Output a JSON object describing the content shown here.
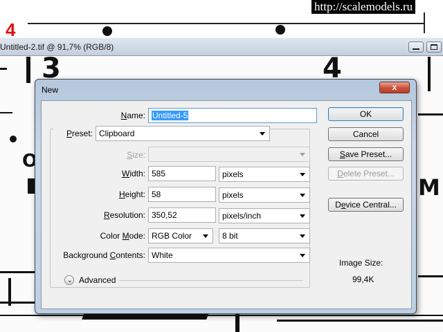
{
  "watermark": "http://scalemodels.ru",
  "step_number": "4",
  "document_window": {
    "title": "Untitled-2.tif @ 91,7% (RGB/8)",
    "minimize_label": "",
    "maximize_label": ""
  },
  "background_glyphs": [
    "3",
    "4",
    "M",
    "O"
  ],
  "dialog": {
    "title": "New",
    "close_label": "x",
    "name": {
      "label_u": "N",
      "label_rest": "ame:",
      "value": "Untitled-5"
    },
    "preset": {
      "label_u": "P",
      "label_rest": "reset:",
      "value": "Clipboard"
    },
    "size": {
      "label_u": "S",
      "label_rest": "ize:",
      "value": ""
    },
    "width": {
      "label_u": "W",
      "label_rest": "idth:",
      "value": "585",
      "unit": "pixels"
    },
    "height": {
      "label_u": "H",
      "label_rest": "eight:",
      "value": "58",
      "unit": "pixels"
    },
    "resolution": {
      "label_u": "R",
      "label_rest": "esolution:",
      "value": "350,52",
      "unit": "pixels/inch"
    },
    "color_mode": {
      "label_pre": "Color ",
      "label_u": "M",
      "label_rest": "ode:",
      "value": "RGB Color",
      "depth": "8 bit"
    },
    "background": {
      "label_pre": "Background ",
      "label_u": "C",
      "label_rest": "ontents:",
      "value": "White"
    },
    "advanced": {
      "label": "Advanced",
      "chevron": "⌄"
    },
    "buttons": {
      "ok": "OK",
      "cancel": "Cancel",
      "save_preset_u": "S",
      "save_preset_rest": "ave Preset...",
      "delete_preset_u": "D",
      "delete_preset_rest": "elete Preset...",
      "device_central_u": "e",
      "device_central_pre": "D",
      "device_central_rest": "vice Central..."
    },
    "image_size": {
      "label": "Image Size:",
      "value": "99,4K"
    }
  },
  "colors": {
    "dialog_frame": "#b5c7dc",
    "client_bg": "#f0f0f0",
    "close_button": "#c9503a",
    "selection": "#3399ff",
    "step_number": "#e01010"
  }
}
